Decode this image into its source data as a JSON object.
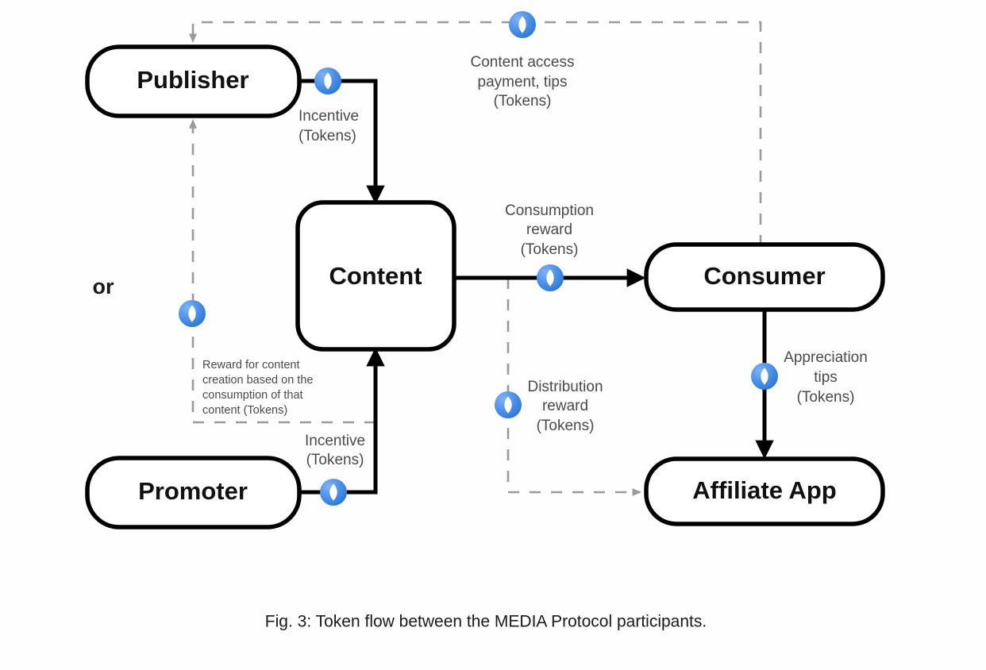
{
  "figure": {
    "caption": "Fig. 3: Token flow between the MEDIA Protocol participants.",
    "or_label": "or"
  },
  "colors": {
    "token_light": "#6fa8f0",
    "token_dark": "#2b77d4",
    "token_inner": "#ffffff",
    "node_stroke": "#000000",
    "node_fill": "#ffffff",
    "solid_edge": "#000000",
    "dashed_edge": "#9a9a9a",
    "label_text": "#4a4a4a",
    "caption_text": "#1a1a1a",
    "background": "#fefefe"
  },
  "nodes": [
    {
      "id": "publisher",
      "label": "Publisher"
    },
    {
      "id": "content",
      "label": "Content"
    },
    {
      "id": "promoter",
      "label": "Promoter"
    },
    {
      "id": "consumer",
      "label": "Consumer"
    },
    {
      "id": "affiliate_app",
      "label": "Affiliate App"
    }
  ],
  "edges": [
    {
      "id": "publisher-to-content",
      "from": "publisher",
      "to": "content",
      "style": "solid",
      "token": true,
      "label_lines": [
        "Incentive",
        "(Tokens)"
      ]
    },
    {
      "id": "consumer-to-publisher",
      "from": "consumer",
      "to": "publisher",
      "style": "dashed",
      "token": true,
      "label_lines": [
        "Content access",
        "payment, tips",
        "(Tokens)"
      ]
    },
    {
      "id": "content-to-consumer",
      "from": "content",
      "to": "consumer",
      "style": "solid",
      "token": true,
      "label_lines": [
        "Consumption",
        "reward",
        "(Tokens)"
      ]
    },
    {
      "id": "consumer-to-affiliate-app",
      "from": "consumer",
      "to": "affiliate_app",
      "style": "solid",
      "token": true,
      "label_lines": [
        "Appreciation",
        "tips",
        "(Tokens)"
      ]
    },
    {
      "id": "content-to-affiliate-app",
      "from": "content",
      "to": "affiliate_app",
      "style": "dashed",
      "token": true,
      "label_lines": [
        "Distribution",
        "reward",
        "(Tokens)"
      ]
    },
    {
      "id": "promoter-to-content",
      "from": "promoter",
      "to": "content",
      "style": "solid",
      "token": true,
      "label_lines": [
        "Incentive",
        "(Tokens)"
      ]
    },
    {
      "id": "reward-to-publisher",
      "from": "content",
      "to": "publisher",
      "style": "dashed",
      "token": true,
      "label_lines": [
        "Reward for content",
        "creation based on the",
        "consumption of that",
        "content (Tokens)"
      ]
    }
  ],
  "labels": {
    "incentive_top_1": "Incentive",
    "incentive_top_2": "(Tokens)",
    "content_access_1": "Content access",
    "content_access_2": "payment, tips",
    "content_access_3": "(Tokens)",
    "consumption_1": "Consumption",
    "consumption_2": "reward",
    "consumption_3": "(Tokens)",
    "appreciation_1": "Appreciation",
    "appreciation_2": "tips",
    "appreciation_3": "(Tokens)",
    "distribution_1": "Distribution",
    "distribution_2": "reward",
    "distribution_3": "(Tokens)",
    "reward_1": "Reward for content",
    "reward_2": "creation based on the",
    "reward_3": "consumption of that",
    "reward_4": "content (Tokens)",
    "incentive_bottom_1": "Incentive",
    "incentive_bottom_2": "(Tokens)"
  },
  "token_icon": {
    "name": "media-token-icon",
    "count": 7
  }
}
